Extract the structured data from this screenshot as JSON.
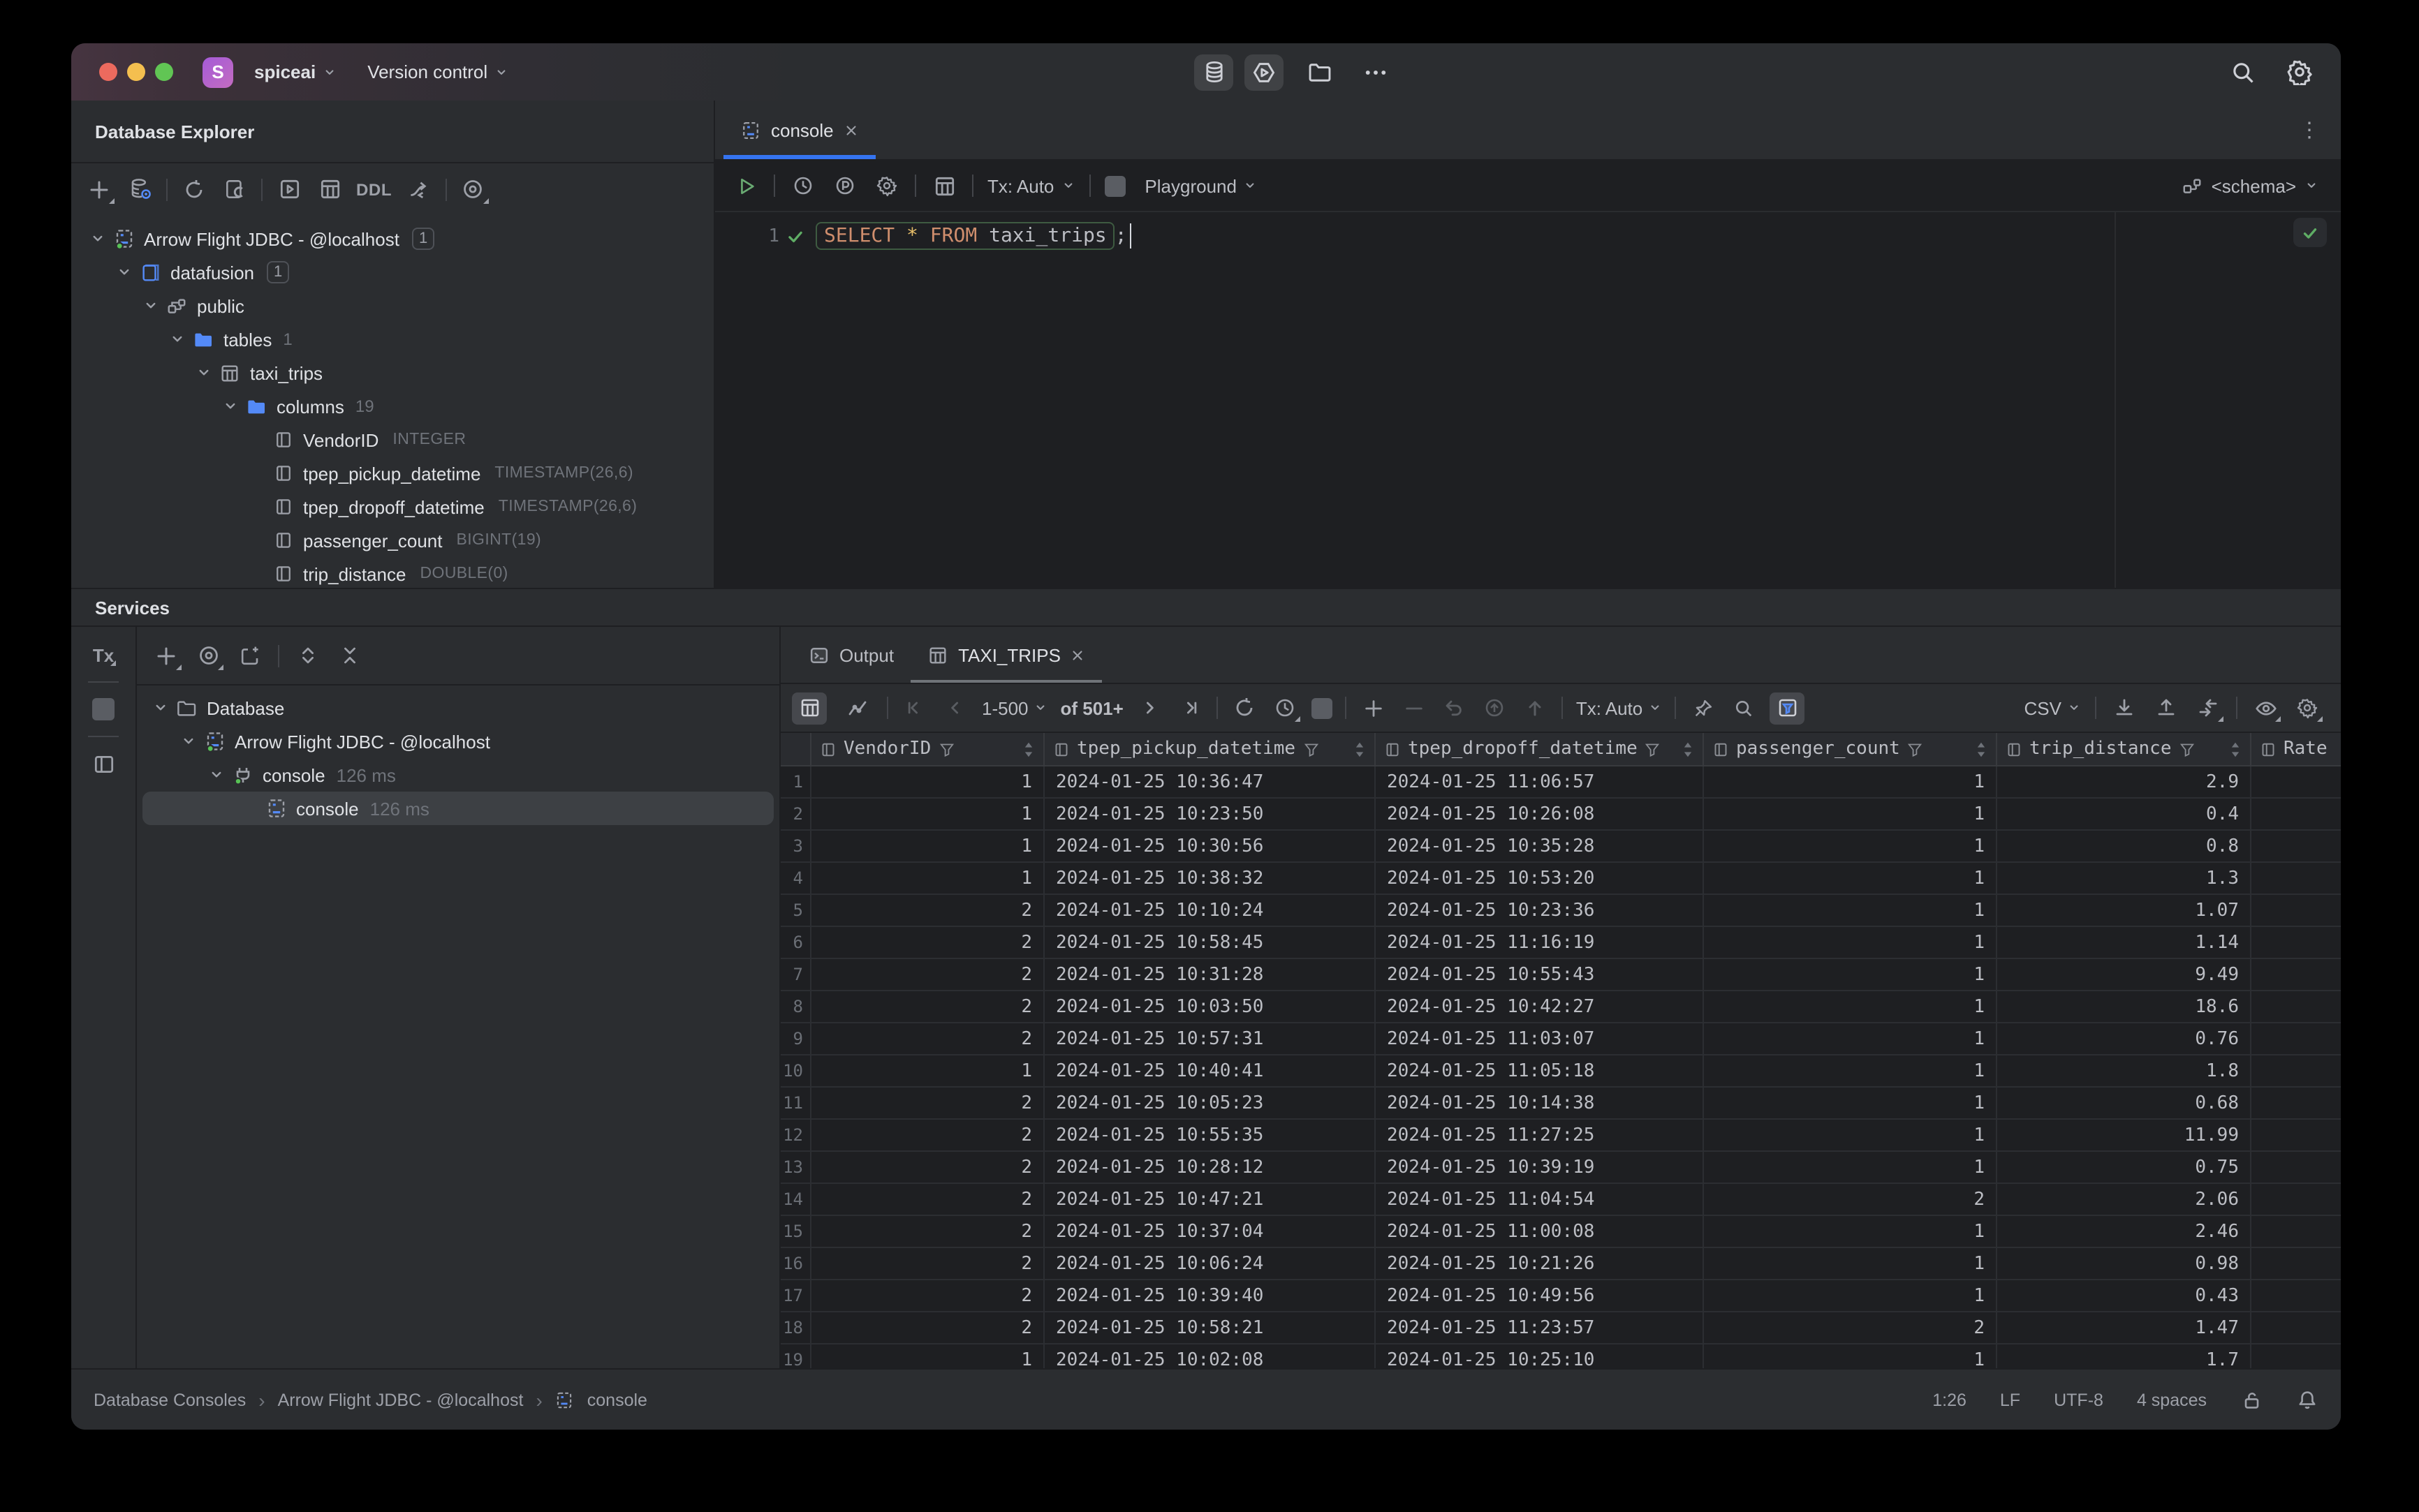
{
  "window": {
    "project": "spiceai",
    "menu": "Version control",
    "avatar_letter": "S",
    "accent_blue": "#3574f0",
    "accent_green": "#57c255"
  },
  "explorer": {
    "title": "Database Explorer",
    "toolbar": {
      "ddl_label": "DDL"
    },
    "tree": [
      {
        "label": "Arrow Flight JDBC - @localhost",
        "badge": "1",
        "icon": "datasource",
        "indent": 0,
        "chevron": true
      },
      {
        "label": "datafusion",
        "badge": "1",
        "icon": "database",
        "indent": 1,
        "chevron": true
      },
      {
        "label": "public",
        "icon": "schema",
        "indent": 2,
        "chevron": true
      },
      {
        "label": "tables",
        "count": "1",
        "icon": "folder",
        "indent": 3,
        "chevron": true
      },
      {
        "label": "taxi_trips",
        "icon": "table",
        "indent": 4,
        "chevron": true
      },
      {
        "label": "columns",
        "count": "19",
        "icon": "folder",
        "indent": 5,
        "chevron": true
      },
      {
        "label": "VendorID",
        "type": "INTEGER",
        "icon": "column",
        "indent": 6
      },
      {
        "label": "tpep_pickup_datetime",
        "type": "TIMESTAMP(26,6)",
        "icon": "column",
        "indent": 6
      },
      {
        "label": "tpep_dropoff_datetime",
        "type": "TIMESTAMP(26,6)",
        "icon": "column",
        "indent": 6
      },
      {
        "label": "passenger_count",
        "type": "BIGINT(19)",
        "icon": "column",
        "indent": 6
      },
      {
        "label": "trip_distance",
        "type": "DOUBLE(0)",
        "icon": "column",
        "indent": 6
      }
    ]
  },
  "editor": {
    "tab": "console",
    "toolbar": {
      "tx": "Tx: Auto",
      "profile": "Playground",
      "schema": "<schema>"
    },
    "line_number": "1",
    "sql": {
      "keyword1": "SELECT",
      "star": "*",
      "keyword2": "FROM",
      "table": "taxi_trips",
      "semicolon": ";"
    }
  },
  "services": {
    "title": "Services",
    "strip_tx": "Tx",
    "tree": [
      {
        "label": "Database",
        "icon": "folder-outline",
        "indent": 0,
        "chevron": true
      },
      {
        "label": "Arrow Flight JDBC - @localhost",
        "icon": "datasource",
        "indent": 1,
        "chevron": true
      },
      {
        "label": "console",
        "suffix": "126 ms",
        "icon": "plug",
        "indent": 2,
        "chevron": true
      },
      {
        "label": "console",
        "suffix": "126 ms",
        "icon": "console",
        "indent": 3,
        "selected": true
      }
    ]
  },
  "results": {
    "tabs": [
      {
        "label": "Output"
      },
      {
        "label": "TAXI_TRIPS"
      }
    ],
    "pagination": {
      "range": "1-500",
      "of": "of 501+"
    },
    "tx": "Tx: Auto",
    "export_format": "CSV",
    "columns": [
      "VendorID",
      "tpep_pickup_datetime",
      "tpep_dropoff_datetime",
      "passenger_count",
      "trip_distance",
      "Rate"
    ],
    "rows": [
      [
        "1",
        "2024-01-25 10:36:47",
        "2024-01-25 11:06:57",
        "1",
        "2.9"
      ],
      [
        "1",
        "2024-01-25 10:23:50",
        "2024-01-25 10:26:08",
        "1",
        "0.4"
      ],
      [
        "1",
        "2024-01-25 10:30:56",
        "2024-01-25 10:35:28",
        "1",
        "0.8"
      ],
      [
        "1",
        "2024-01-25 10:38:32",
        "2024-01-25 10:53:20",
        "1",
        "1.3"
      ],
      [
        "2",
        "2024-01-25 10:10:24",
        "2024-01-25 10:23:36",
        "1",
        "1.07"
      ],
      [
        "2",
        "2024-01-25 10:58:45",
        "2024-01-25 11:16:19",
        "1",
        "1.14"
      ],
      [
        "2",
        "2024-01-25 10:31:28",
        "2024-01-25 10:55:43",
        "1",
        "9.49"
      ],
      [
        "2",
        "2024-01-25 10:03:50",
        "2024-01-25 10:42:27",
        "1",
        "18.6"
      ],
      [
        "2",
        "2024-01-25 10:57:31",
        "2024-01-25 11:03:07",
        "1",
        "0.76"
      ],
      [
        "1",
        "2024-01-25 10:40:41",
        "2024-01-25 11:05:18",
        "1",
        "1.8"
      ],
      [
        "2",
        "2024-01-25 10:05:23",
        "2024-01-25 10:14:38",
        "1",
        "0.68"
      ],
      [
        "2",
        "2024-01-25 10:55:35",
        "2024-01-25 11:27:25",
        "1",
        "11.99"
      ],
      [
        "2",
        "2024-01-25 10:28:12",
        "2024-01-25 10:39:19",
        "1",
        "0.75"
      ],
      [
        "2",
        "2024-01-25 10:47:21",
        "2024-01-25 11:04:54",
        "2",
        "2.06"
      ],
      [
        "2",
        "2024-01-25 10:37:04",
        "2024-01-25 11:00:08",
        "1",
        "2.46"
      ],
      [
        "2",
        "2024-01-25 10:06:24",
        "2024-01-25 10:21:26",
        "1",
        "0.98"
      ],
      [
        "2",
        "2024-01-25 10:39:40",
        "2024-01-25 10:49:56",
        "1",
        "0.43"
      ],
      [
        "2",
        "2024-01-25 10:58:21",
        "2024-01-25 11:23:57",
        "2",
        "1.47"
      ],
      [
        "1",
        "2024-01-25 10:02:08",
        "2024-01-25 10:25:10",
        "1",
        "1.7"
      ]
    ]
  },
  "status_bar": {
    "breadcrumbs": [
      "Database Consoles",
      "Arrow Flight JDBC - @localhost",
      "console"
    ],
    "caret": "1:26",
    "line_ending": "LF",
    "encoding": "UTF-8",
    "indent": "4 spaces"
  }
}
